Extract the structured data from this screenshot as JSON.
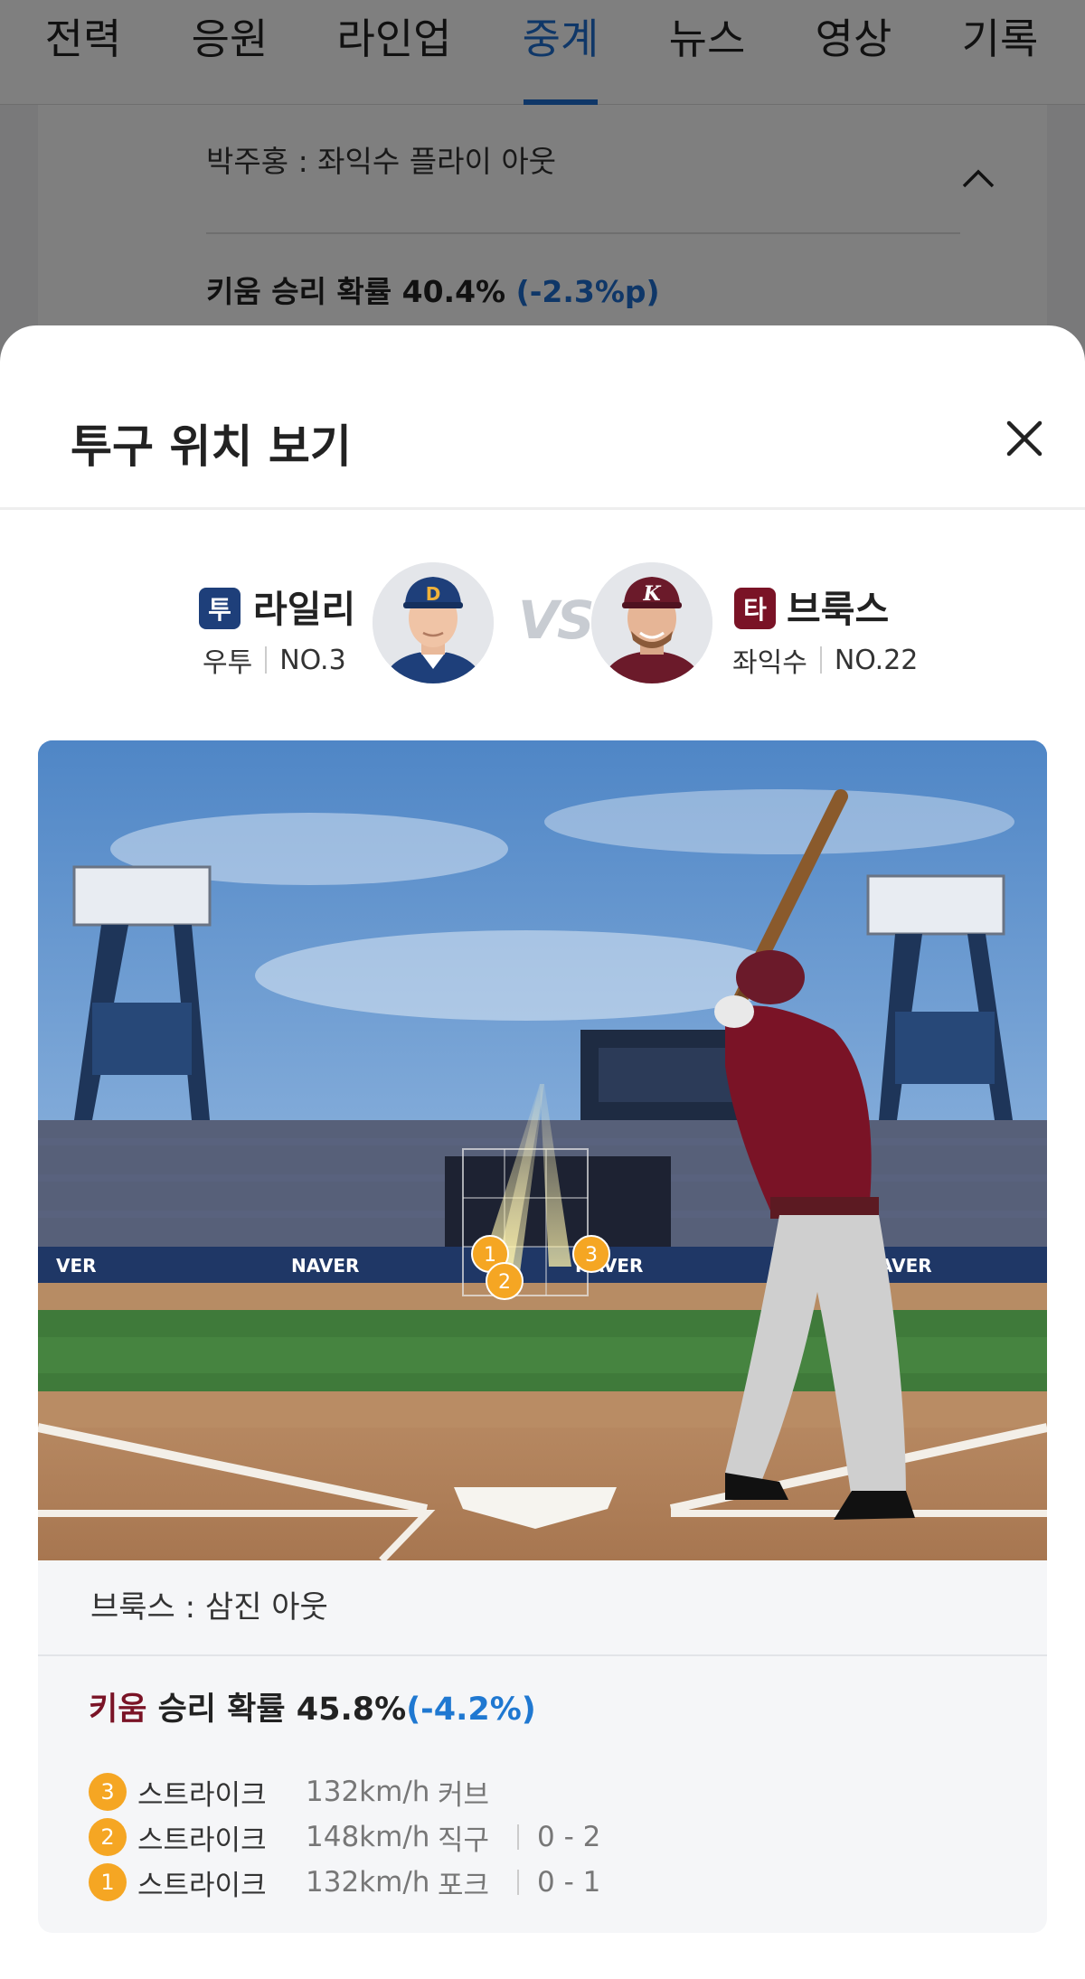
{
  "tabs": [
    {
      "label": "전력",
      "active": false
    },
    {
      "label": "응원",
      "active": false
    },
    {
      "label": "라인업",
      "active": false
    },
    {
      "label": "중계",
      "active": true
    },
    {
      "label": "뉴스",
      "active": false
    },
    {
      "label": "영상",
      "active": false
    },
    {
      "label": "기록",
      "active": false
    }
  ],
  "background_feed": {
    "event": "박주홍 : 좌익수 플라이 아웃",
    "win_prob_text": "키움 승리 확률 40.4%",
    "win_prob_delta": "(-2.3%p)"
  },
  "sheet": {
    "title": "투구 위치 보기",
    "close_icon": "close-icon"
  },
  "matchup": {
    "pitcher": {
      "badge": "투",
      "name": "라일리",
      "hand": "우투",
      "number": "NO.3",
      "badge_color": "#1e3f7a",
      "cap_color": "#1e3f7a"
    },
    "vs": "VS",
    "batter": {
      "badge": "타",
      "name": "브룩스",
      "hand": "좌익수",
      "number": "NO.22",
      "badge_color": "#7a1326",
      "cap_color": "#6b1a2a",
      "cap_logo": "K"
    }
  },
  "stadium": {
    "ads": [
      "NAVER",
      "NAVER",
      "NAVER",
      "NAVER SPORTS"
    ],
    "pitch_markers": [
      "1",
      "2",
      "3"
    ]
  },
  "result": {
    "event": "브룩스 : 삼진 아웃",
    "team": "키움",
    "prob_text": " 승리 확률 45.8%",
    "delta": "(-4.2%)",
    "pitches": [
      {
        "num": "3",
        "type": "스트라이크",
        "speed": "132km/h",
        "kind": "커브",
        "count": ""
      },
      {
        "num": "2",
        "type": "스트라이크",
        "speed": "148km/h",
        "kind": "직구",
        "count": "0 - 2"
      },
      {
        "num": "1",
        "type": "스트라이크",
        "speed": "132km/h",
        "kind": "포크",
        "count": "0 - 1"
      }
    ],
    "marker_color": "#f5a623"
  }
}
